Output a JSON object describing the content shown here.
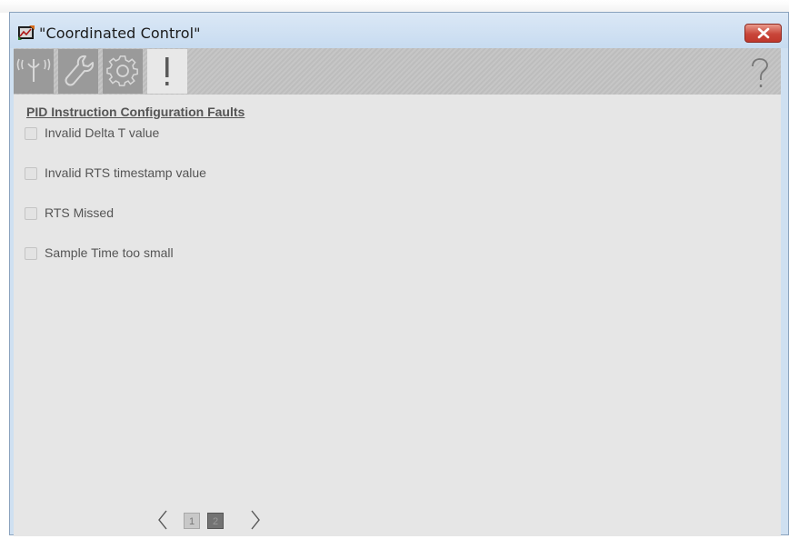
{
  "window": {
    "title": "\"Coordinated Control\""
  },
  "toolbar": {
    "tabs": [
      {
        "icon": "signal-antenna-icon",
        "active": false
      },
      {
        "icon": "wrench-icon",
        "active": false
      },
      {
        "icon": "gear-icon",
        "active": false
      },
      {
        "icon": "exclamation-icon",
        "active": true
      }
    ],
    "help_icon": "question-mark-icon"
  },
  "faults": {
    "section_title": "PID Instruction Configuration Faults",
    "items": [
      {
        "label": "Invalid Delta T value",
        "checked": false
      },
      {
        "label": "Invalid RTS timestamp value",
        "checked": false
      },
      {
        "label": "RTS Missed",
        "checked": false
      },
      {
        "label": "Sample Time too small",
        "checked": false
      }
    ]
  },
  "pager": {
    "pages": [
      "1",
      "2"
    ],
    "current_page": "2"
  }
}
